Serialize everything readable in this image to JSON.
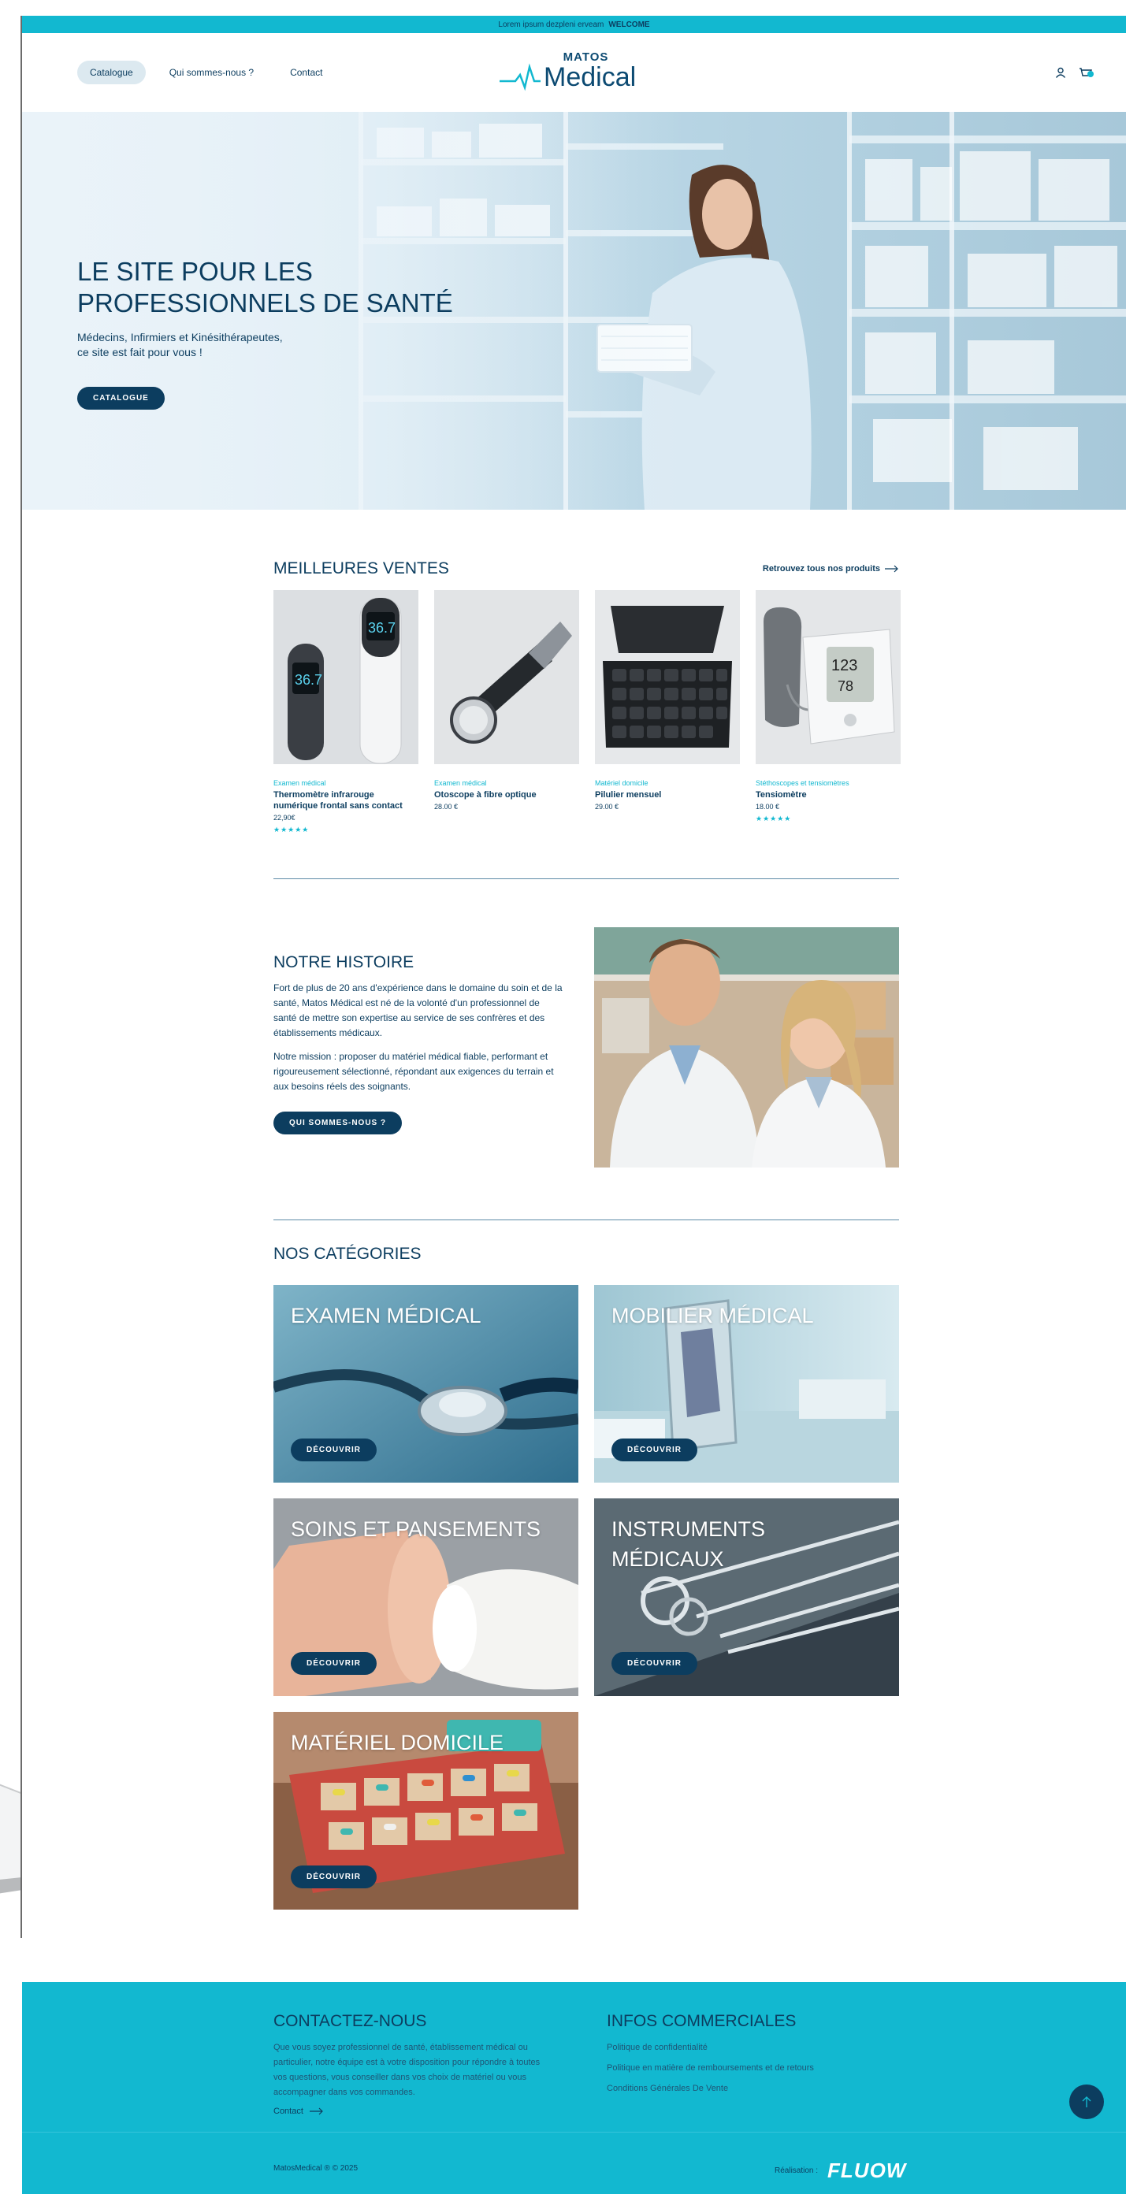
{
  "topbar": {
    "text": "Lorem ipsum dezpleni erveam",
    "highlight": "WELCOME"
  },
  "nav": {
    "items": [
      {
        "label": "Catalogue",
        "active": true
      },
      {
        "label": "Qui sommes-nous ?",
        "active": false
      },
      {
        "label": "Contact",
        "active": false
      }
    ]
  },
  "logo": {
    "top": "MATOS",
    "main": "Medical"
  },
  "icons": {
    "account": "user-icon",
    "cart": "cart-icon"
  },
  "hero": {
    "title_line1": "LE SITE POUR LES",
    "title_line2": "PROFESSIONNELS DE SANTÉ",
    "sub_line1": "Médecins, Infirmiers et Kinésithérapeutes,",
    "sub_line2": "ce site est fait pour vous !",
    "button": "CATALOGUE"
  },
  "bestsellers": {
    "title": "MEILLEURES VENTES",
    "link": "Retrouvez tous nos produits",
    "products": [
      {
        "category": "Examen médical",
        "name": "Thermomètre infrarouge numérique frontal sans contact",
        "price": "22,90€",
        "rating": "★★★★★"
      },
      {
        "category": "Examen médical",
        "name": "Otoscope à fibre optique",
        "price": "28.00 €",
        "rating": ""
      },
      {
        "category": "Matériel domicile",
        "name": "Pilulier mensuel",
        "price": "29.00 €",
        "rating": ""
      },
      {
        "category": "Stéthoscopes et tensiomètres",
        "name": "Tensiomètre",
        "price": "18.00 €",
        "rating": "★★★★★"
      }
    ]
  },
  "history": {
    "title": "NOTRE HISTOIRE",
    "p1": "Fort de plus de 20 ans d'expérience dans le domaine du soin et de la santé, Matos Médical est né de la volonté d'un professionnel de santé de mettre son expertise au service de ses confrères et des établissements médicaux.",
    "p2": "Notre mission : proposer du matériel médical fiable, performant et rigoureusement sélectionné, répondant aux exigences du terrain et aux besoins réels des soignants.",
    "button": "QUI SOMMES-NOUS ?"
  },
  "categories": {
    "title": "NOS CATÉGORIES",
    "items": [
      {
        "name": "EXAMEN MÉDICAL",
        "button": "DÉCOUVRIR"
      },
      {
        "name": "MOBILIER MÉDICAL",
        "button": "DÉCOUVRIR"
      },
      {
        "name": "SOINS ET PANSEMENTS",
        "button": "DÉCOUVRIR"
      },
      {
        "name": "INSTRUMENTS MÉDICAUX",
        "button": "DÉCOUVRIR"
      },
      {
        "name": "MATÉRIEL DOMICILE",
        "button": "DÉCOUVRIR"
      }
    ]
  },
  "footer": {
    "contact_title": "CONTACTEZ-NOUS",
    "contact_text": "Que vous soyez professionnel de santé, établissement médical ou particulier, notre équipe est à votre disposition pour répondre à toutes vos questions, vous conseiller dans vos choix de matériel ou vous accompagner dans vos commandes.",
    "contact_link": "Contact",
    "infos_title": "INFOS COMMERCIALES",
    "links": [
      "Politique de confidentialité",
      "Politique en matière de remboursements et de retours",
      "Conditions Générales De Vente"
    ],
    "copyright": "MatosMedical ® © 2025",
    "realisation": "Réalisation :",
    "brand": "FLUOW"
  },
  "colors": {
    "accent": "#12b8d0",
    "navy": "#0c3d5f"
  }
}
